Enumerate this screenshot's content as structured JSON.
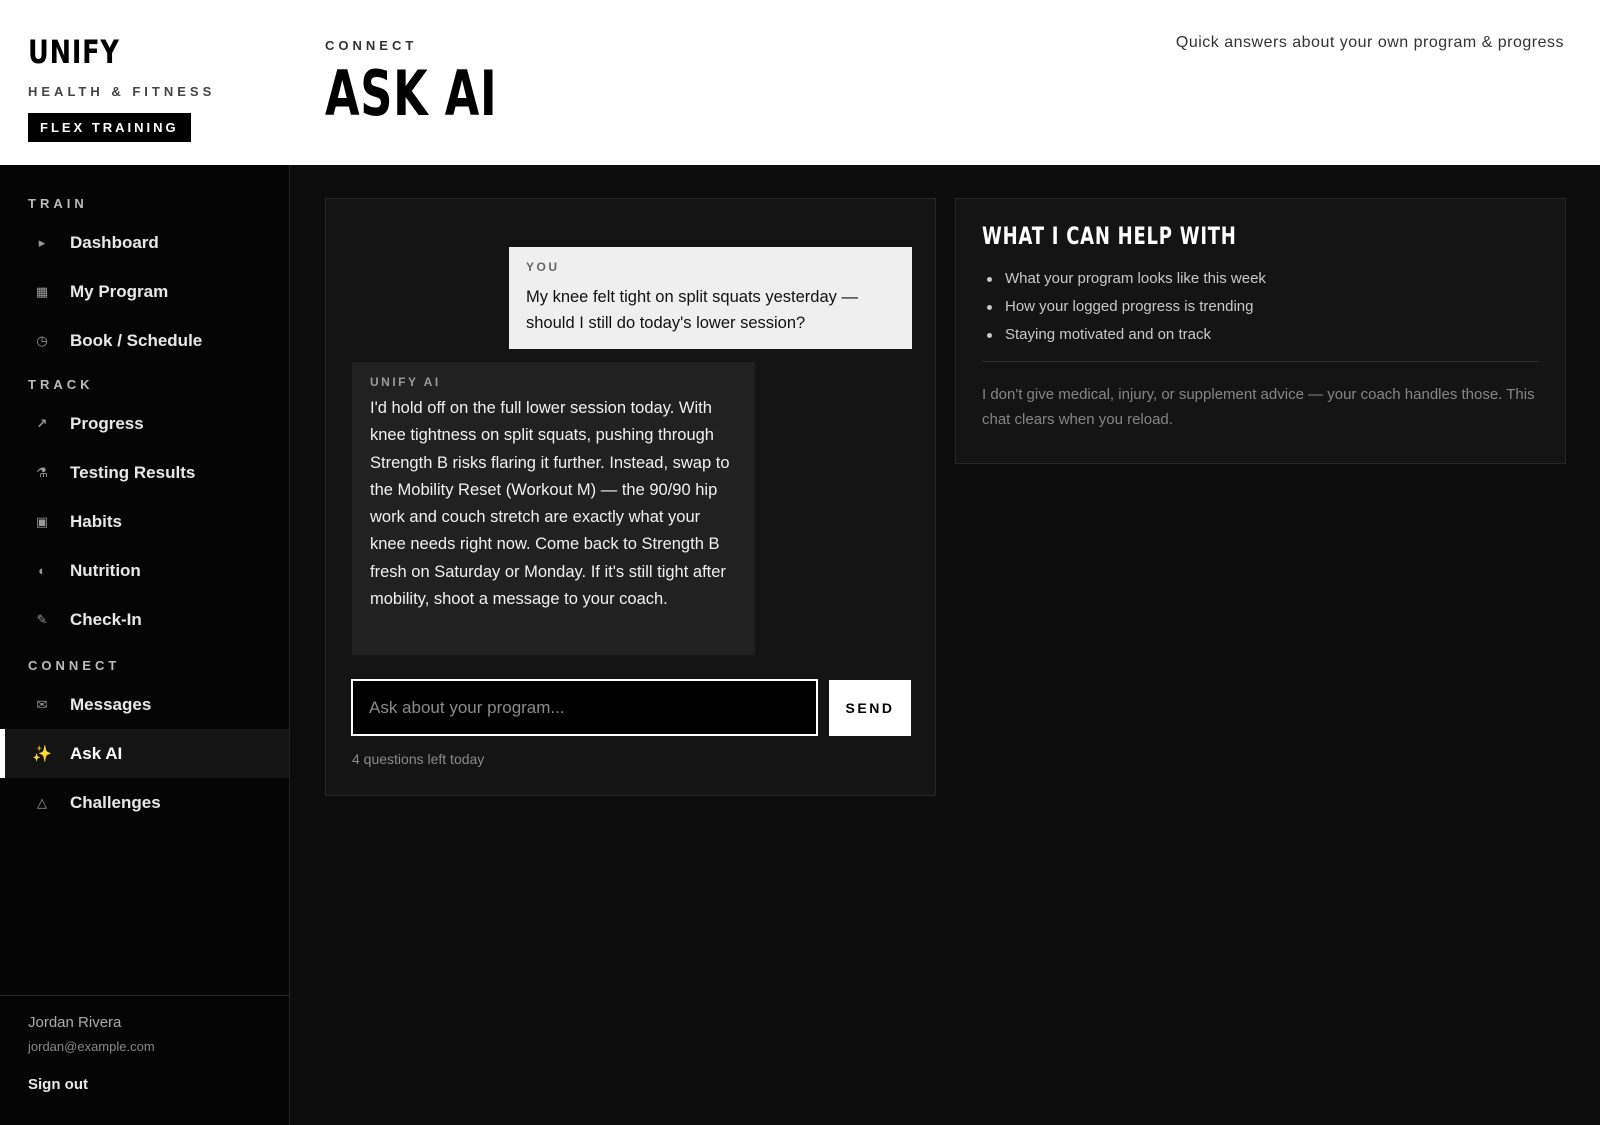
{
  "brand": {
    "name": "UNIFY",
    "tagline": "HEALTH & FITNESS",
    "badge": "FLEX TRAINING"
  },
  "header": {
    "breadcrumb": "CONNECT",
    "title": "ASK AI",
    "subtitle": "Quick answers about your own program & progress"
  },
  "sidebar": {
    "sections": [
      {
        "title": "TRAIN",
        "items": [
          {
            "label": "Dashboard",
            "icon": "triangle-right-icon"
          },
          {
            "label": "My Program",
            "icon": "grid-icon"
          },
          {
            "label": "Book / Schedule",
            "icon": "clock-icon"
          }
        ]
      },
      {
        "title": "TRACK",
        "items": [
          {
            "label": "Progress",
            "icon": "trend-arrow-icon"
          },
          {
            "label": "Testing Results",
            "icon": "flask-icon"
          },
          {
            "label": "Habits",
            "icon": "square-check-icon"
          },
          {
            "label": "Nutrition",
            "icon": "half-circle-icon"
          },
          {
            "label": "Check-In",
            "icon": "pencil-icon"
          }
        ]
      },
      {
        "title": "CONNECT",
        "items": [
          {
            "label": "Messages",
            "icon": "envelope-icon"
          },
          {
            "label": "Ask AI",
            "icon": "sparkles-icon",
            "active": true
          },
          {
            "label": "Challenges",
            "icon": "triangle-icon"
          }
        ]
      }
    ],
    "user": {
      "name": "Jordan Rivera",
      "email": "jordan@example.com",
      "signout": "Sign out"
    }
  },
  "chat": {
    "messages": [
      {
        "sender": "YOU",
        "text": "My knee felt tight on split squats yesterday — should I still do today's lower session?"
      },
      {
        "sender": "UNIFY AI",
        "text": "I'd hold off on the full lower session today. With knee tightness on split squats, pushing through Strength B risks flaring it further. Instead, swap to the Mobility Reset (Workout M) — the 90/90 hip work and couch stretch are exactly what your knee needs right now. Come back to Strength B fresh on Saturday or Monday. If it's still tight after mobility, shoot a message to your coach."
      }
    ],
    "input_placeholder": "Ask about your program...",
    "input_value": "",
    "send_label": "SEND",
    "quota": "4 questions left today"
  },
  "help": {
    "title": "WHAT I CAN HELP WITH",
    "items": [
      "What your program looks like this week",
      "How your logged progress is trending",
      "Staying motivated and on track"
    ],
    "note": "I don't give medical, injury, or supplement advice — your coach handles those. This chat clears when you reload."
  },
  "colors": {
    "accent": "#ffffff",
    "background": "#0c0c0c",
    "panel": "#141414",
    "active_icon": "#f5c518"
  }
}
